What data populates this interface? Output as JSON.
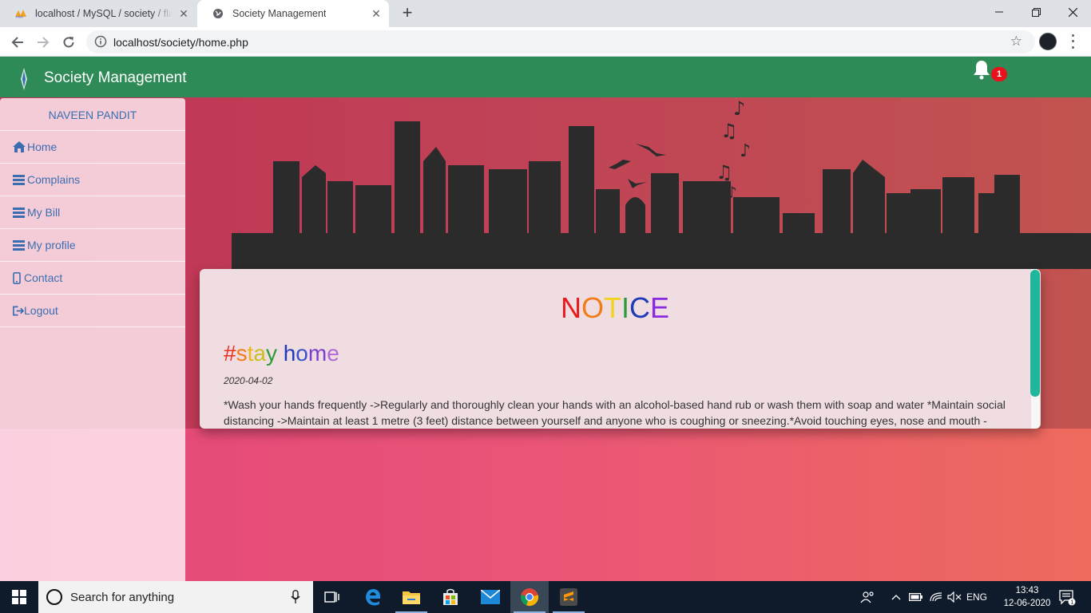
{
  "browser": {
    "tabs": [
      {
        "title": "localhost / MySQL / society / flat",
        "active": false
      },
      {
        "title": "Society Management",
        "active": true
      }
    ],
    "url": "localhost/society/home.php"
  },
  "navbar": {
    "brand": "Society Management",
    "notification_count": "1",
    "color": "#2e8b57"
  },
  "sidebar": {
    "user": "NAVEEN PANDIT",
    "items": [
      {
        "label": "Home",
        "icon": "home-icon"
      },
      {
        "label": "Complains",
        "icon": "list-icon"
      },
      {
        "label": "My Bill",
        "icon": "list-icon"
      },
      {
        "label": "My profile",
        "icon": "list-icon"
      },
      {
        "label": "Contact",
        "icon": "phone-icon"
      },
      {
        "label": "Logout",
        "icon": "logout-icon"
      }
    ]
  },
  "notice": {
    "title_letters": [
      {
        "ch": "N",
        "color": "#e81c1c"
      },
      {
        "ch": "O",
        "color": "#f07d16"
      },
      {
        "ch": "T",
        "color": "#f2d21a"
      },
      {
        "ch": "I",
        "color": "#2e9b3a"
      },
      {
        "ch": "C",
        "color": "#1f3bb8"
      },
      {
        "ch": "E",
        "color": "#8a2be2"
      }
    ],
    "heading": "#stay home",
    "date": "2020-04-02",
    "body": "*Wash your hands frequently ->Regularly and thoroughly clean your hands with an alcohol-based hand rub or wash them with soap and water *Maintain social distancing ->Maintain at least 1 metre (3 feet) distance between yourself and anyone who is coughing or sneezing.*Avoid touching eyes, nose and mouth -"
  },
  "taskbar": {
    "search_placeholder": "Search for anything",
    "language": "ENG",
    "time": "13:43",
    "date": "12-06-2020",
    "notification_count": "1"
  }
}
